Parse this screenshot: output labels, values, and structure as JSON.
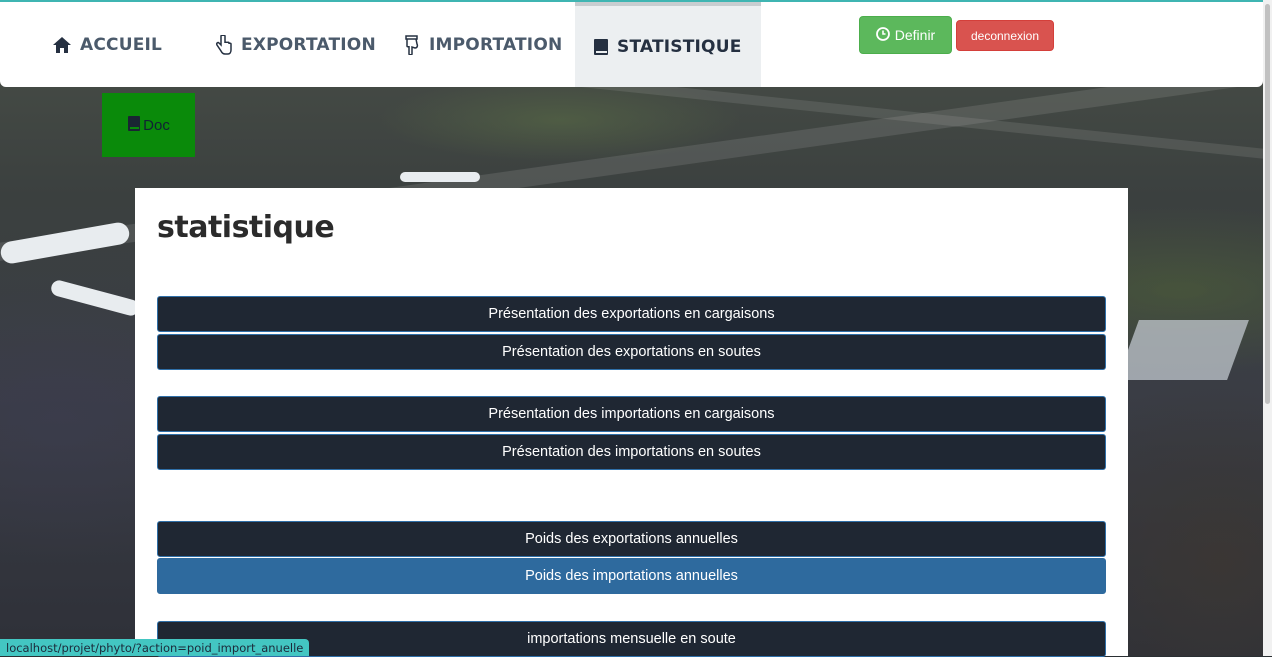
{
  "nav": {
    "items": [
      {
        "label": "ACCUEIL",
        "icon": "home-icon"
      },
      {
        "label": "EXPORTATION",
        "icon": "hand-pointer-icon"
      },
      {
        "label": "IMPORTATION",
        "icon": "hand-down-icon"
      },
      {
        "label": "STATISTIQUE",
        "icon": "book-icon",
        "active": true
      }
    ],
    "definir_label": "Definir",
    "deconnexion_label": "deconnexion"
  },
  "doc": {
    "label": "Doc"
  },
  "main": {
    "title": "statistique",
    "buttons": [
      "Présentation des exportations en cargaisons",
      "Présentation des exportations en soutes",
      "Présentation des importations en cargaisons",
      "Présentation des importations en soutes",
      "Poids des exportations annuelles",
      "Poids des importations annuelles",
      "importations mensuelle en soute"
    ]
  },
  "status_url": "localhost/projet/phyto/?action=poid_import_anuelle",
  "colors": {
    "accent_teal": "#3fb5b2",
    "button_dark": "#1f2733",
    "button_selected": "#2e6a9e",
    "success": "#5cb85c",
    "danger": "#d9534f",
    "doc_green": "#0a8a0a"
  }
}
